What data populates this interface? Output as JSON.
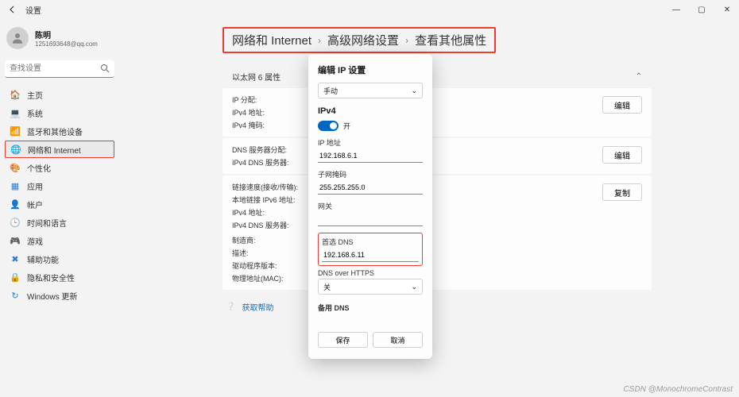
{
  "window": {
    "title": "设置",
    "min": "—",
    "max": "▢",
    "close": "✕"
  },
  "user": {
    "name": "陈明",
    "email": "1251693648@qq.com"
  },
  "search": {
    "placeholder": "查找设置"
  },
  "nav": [
    {
      "icon": "🏠",
      "label": "主页",
      "color": "#5b7fa6"
    },
    {
      "icon": "💻",
      "label": "系统",
      "color": "#5b7fa6"
    },
    {
      "icon": "📶",
      "label": "蓝牙和其他设备",
      "color": "#2b7cd3"
    },
    {
      "icon": "🌐",
      "label": "网络和 Internet",
      "color": "#2b7cd3",
      "active": true,
      "outline": true
    },
    {
      "icon": "🎨",
      "label": "个性化",
      "color": "#c23f8e"
    },
    {
      "icon": "▦",
      "label": "应用",
      "color": "#2b7cd3"
    },
    {
      "icon": "👤",
      "label": "帐户",
      "color": "#d08a3a"
    },
    {
      "icon": "🕒",
      "label": "时间和语言",
      "color": "#2b7cd3"
    },
    {
      "icon": "🎮",
      "label": "游戏",
      "color": "#5fa65b"
    },
    {
      "icon": "✖",
      "label": "辅助功能",
      "color": "#2b7cd3"
    },
    {
      "icon": "🔒",
      "label": "隐私和安全性",
      "color": "#5b7fa6"
    },
    {
      "icon": "↻",
      "label": "Windows 更新",
      "color": "#2b7cd3"
    }
  ],
  "breadcrumb": [
    "网络和 Internet",
    "高级网络设置",
    "查看其他属性"
  ],
  "section_title": "以太网 6 属性",
  "cards": [
    {
      "labels": [
        "IP 分配:",
        "IPv4 地址:",
        "IPv4 掩码:"
      ],
      "action": "编辑"
    },
    {
      "labels": [
        "DNS 服务器分配:",
        "IPv4 DNS 服务器:"
      ],
      "action": "编辑"
    },
    {
      "labels": [
        "链接速度(接收/传输):",
        "本地链接 IPv6 地址:",
        "IPv4 地址:",
        "IPv4 DNS 服务器:",
        "",
        "制造商:",
        "描述:",
        "驱动程序版本:",
        "物理地址(MAC):"
      ],
      "action": "复制"
    }
  ],
  "gethelp": "获取帮助",
  "dialog": {
    "title": "编辑 IP 设置",
    "mode": "手动",
    "ipv4_label": "IPv4",
    "toggle_on": "开",
    "fields": {
      "ip_label": "IP 地址",
      "ip_value": "192.168.6.1",
      "mask_label": "子网掩码",
      "mask_value": "255.255.255.0",
      "gw_label": "网关",
      "gw_value": "",
      "dns1_label": "首选 DNS",
      "dns1_value": "192.168.6.11",
      "doh_label": "DNS over HTTPS",
      "doh_value": "关",
      "dns2_label": "备用 DNS"
    },
    "save": "保存",
    "cancel": "取消"
  },
  "watermark": "CSDN @MonochromeContrast",
  "colors": {
    "accent": "#0067c0",
    "highlight_border": "#ef3b2d"
  }
}
